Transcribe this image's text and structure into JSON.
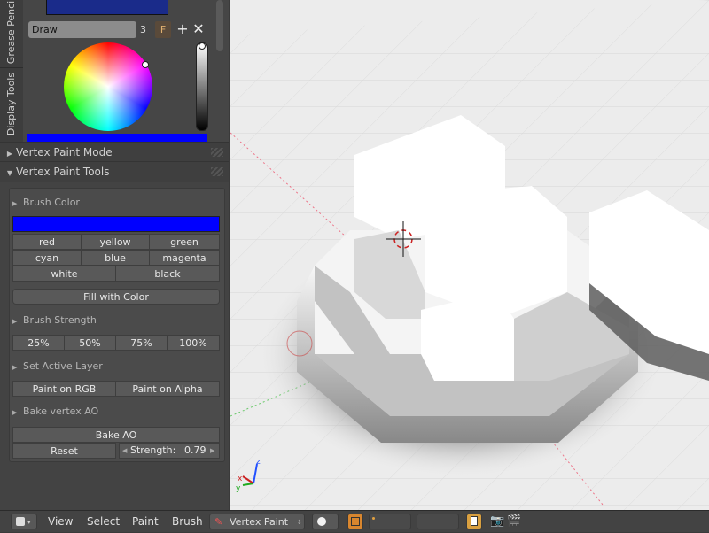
{
  "sidebar": {
    "tabs": [
      "Grease Penci",
      "Display Tools"
    ],
    "brush": {
      "name": "Draw",
      "users": "3",
      "fake_user": "F",
      "add": "+",
      "remove": "✕"
    },
    "current_color": "#0000ff"
  },
  "panels": {
    "vertex_paint_mode": "Vertex Paint Mode",
    "vertex_paint_tools": "Vertex Paint Tools"
  },
  "tools": {
    "brush_color": {
      "label": "Brush Color",
      "swatch_color": "#0000ff",
      "colors": [
        "red",
        "yellow",
        "green",
        "cyan",
        "blue",
        "magenta",
        "white",
        "black"
      ]
    },
    "fill_label": "Fill with Color",
    "brush_strength": {
      "label": "Brush Strength",
      "options": [
        "25%",
        "50%",
        "75%",
        "100%"
      ]
    },
    "set_active_layer": {
      "label": "Set Active Layer",
      "options": [
        "Paint on RGB",
        "Paint on Alpha"
      ]
    },
    "bake_vertex_ao": {
      "label": "Bake vertex AO",
      "bake_label": "Bake AO",
      "reset_label": "Reset",
      "strength_label": "Strength:",
      "strength_value": "0.79"
    }
  },
  "viewport": {
    "axis_x": "x",
    "axis_y": "y",
    "axis_z": "z"
  },
  "header": {
    "menus": [
      "View",
      "Select",
      "Paint",
      "Brush"
    ],
    "mode": "Vertex Paint"
  }
}
